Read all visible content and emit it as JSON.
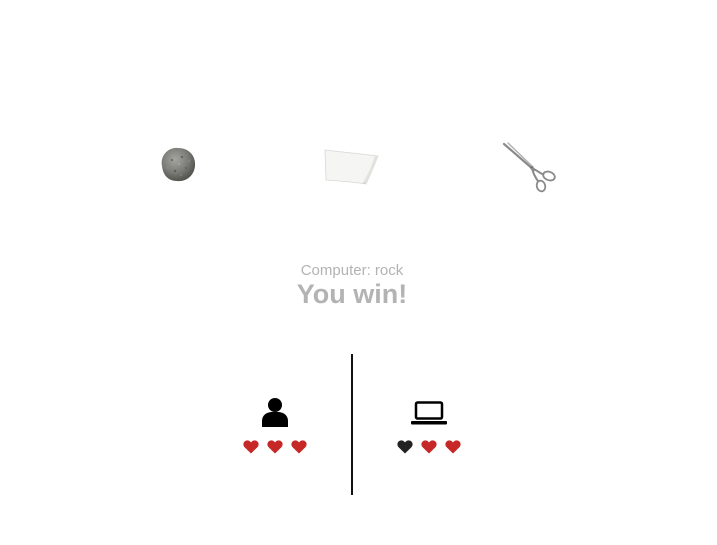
{
  "choices": [
    {
      "name": "rock",
      "icon": "rock-icon"
    },
    {
      "name": "paper",
      "icon": "paper-icon"
    },
    {
      "name": "scissors",
      "icon": "scissors-icon"
    }
  ],
  "result": {
    "computer_choice": "Computer: rock",
    "outcome": "You win!"
  },
  "players": {
    "user": {
      "icon": "user-icon",
      "lives_total": 3,
      "lives_remaining": 3
    },
    "computer": {
      "icon": "laptop-icon",
      "lives_total": 3,
      "lives_remaining": 2
    }
  },
  "colors": {
    "heart_full": "#c62828",
    "heart_lost": "#222222",
    "result_text": "#b3b3b3"
  }
}
